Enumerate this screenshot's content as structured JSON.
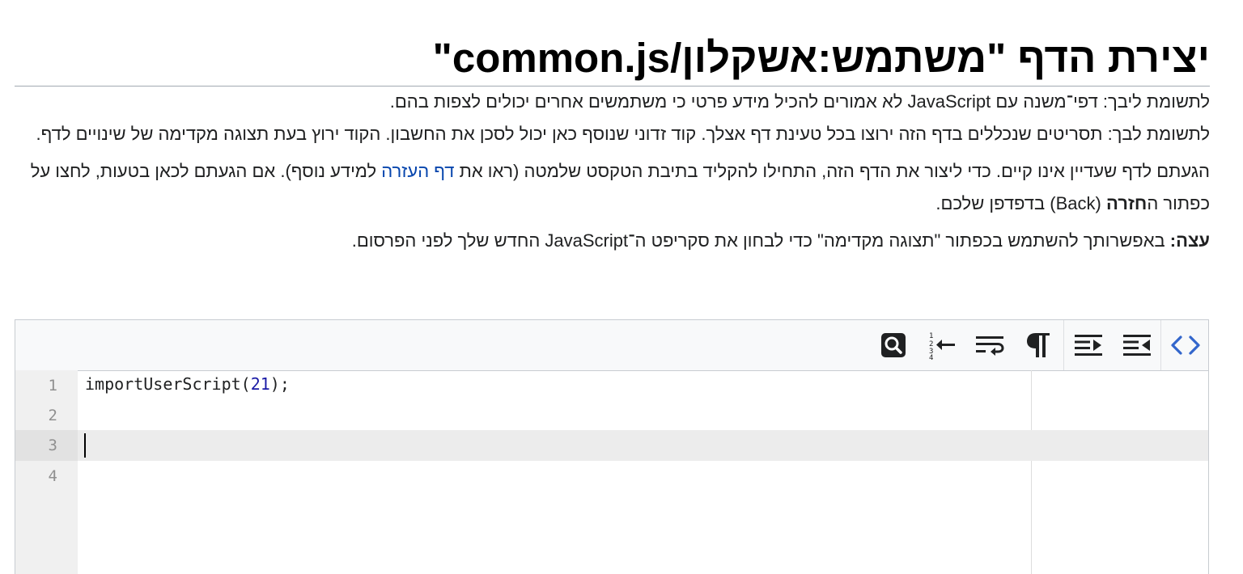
{
  "page": {
    "title": "יצירת הדף \"משתמש:אשקלון/common.js\""
  },
  "notices": {
    "caution_js_public": "לתשומת ליבך: דפי־משנה עם JavaScript לא אמורים להכיל מידע פרטי כי משתמשים אחרים יכולים לצפות בהם.",
    "caution_scripts": "לתשומת לבך: תסריטים שנכללים בדף הזה ירוצו בכל טעינת דף אצלך. קוד זדוני שנוסף כאן יכול לסכן את החשבון. הקוד ירוץ בעת תצוגה מקדימה של שינויים לדף.",
    "nonexistent_before_link": "הגעתם לדף שעדיין אינו קיים. כדי ליצור את הדף הזה, התחילו להקליד בתיבת הטקסט שלמטה (ראו את ",
    "help_link": "דף העזרה",
    "nonexistent_after_link": " למידע נוסף). אם הגעתם לכאן בטעות, לחצו על כפתור ה",
    "back_bold": "חזרה",
    "nonexistent_end": " (Back) בדפדפן שלכם.",
    "tip_bold": "עצה:",
    "tip_text": " באפשרותך להשתמש בכפתור \"תצוגה מקדימה\" כדי לבחון את סקריפט ה־JavaScript החדש שלך לפני הפרסום."
  },
  "toolbar": {
    "buttons": [
      {
        "id": "code-toggle",
        "icon": "code-brackets-icon",
        "active": true
      },
      {
        "id": "indent",
        "icon": "indent-icon"
      },
      {
        "id": "outdent",
        "icon": "outdent-icon"
      },
      {
        "id": "invisibles",
        "icon": "pilcrow-icon"
      },
      {
        "id": "wrap",
        "icon": "line-wrap-icon"
      },
      {
        "id": "goto-line",
        "icon": "goto-line-icon"
      },
      {
        "id": "search",
        "icon": "search-icon"
      }
    ],
    "accent_color": "#3366cc"
  },
  "editor": {
    "lines": [
      {
        "number": "1",
        "text_name": "importUserScript(",
        "text_num": "21",
        "text_end": ");"
      },
      {
        "number": "2",
        "text_name": "",
        "text_num": "",
        "text_end": ""
      },
      {
        "number": "3",
        "text_name": "",
        "text_num": "",
        "text_end": ""
      },
      {
        "number": "4",
        "text_name": "",
        "text_num": "",
        "text_end": ""
      }
    ],
    "active_line": 3
  }
}
